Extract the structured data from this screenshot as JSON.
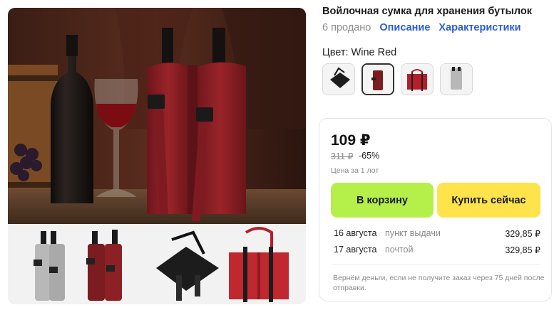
{
  "product": {
    "title": "Войлочная сумка для хранения бутылок",
    "sold": "6 продано",
    "tabs": [
      "Описание",
      "Характеристики"
    ]
  },
  "variant": {
    "label": "Цвет: Wine Red",
    "swatches": [
      {
        "name": "black",
        "color": "#222222",
        "selected": false
      },
      {
        "name": "wine-red",
        "color": "#7a1c20",
        "selected": true
      },
      {
        "name": "red",
        "color": "#b3202a",
        "selected": false
      },
      {
        "name": "grey",
        "color": "#b7b7b7",
        "selected": false
      }
    ]
  },
  "pricing": {
    "price": "109 ₽",
    "old_price": "311 ₽",
    "discount": "-65%",
    "per_lot": "Цена за 1 лот"
  },
  "actions": {
    "cart": "В корзину",
    "buy_now": "Купить сейчас"
  },
  "shipping": [
    {
      "date": "16 августа",
      "method": "пункт выдачи",
      "cost": "329,85 ₽"
    },
    {
      "date": "17 августа",
      "method": "почтой",
      "cost": "329,85 ₽"
    }
  ],
  "refund_note": "Вернём деньги, если не получите заказ через 75 дней после отправки.",
  "colors": {
    "link": "#2a5bd7",
    "cart_button": "#b5ef4a",
    "buy_button": "#fee34a",
    "felt_wine": "#8b1f24"
  }
}
